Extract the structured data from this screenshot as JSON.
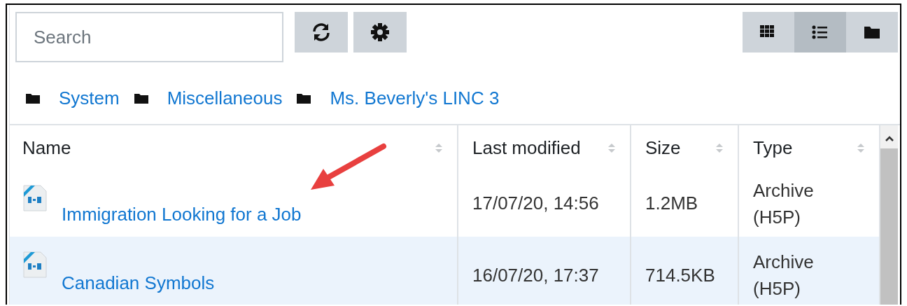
{
  "search": {
    "placeholder": "Search"
  },
  "toolbar_buttons": [
    {
      "kind": "refresh"
    },
    {
      "kind": "settings"
    }
  ],
  "view_modes": [
    {
      "kind": "icons",
      "selected": false
    },
    {
      "kind": "list",
      "selected": true
    },
    {
      "kind": "tree",
      "selected": false
    }
  ],
  "breadcrumb": [
    "System",
    "Miscellaneous",
    "Ms. Beverly's LINC 3"
  ],
  "table": {
    "columns": [
      "Name",
      "Last modified",
      "Size",
      "Type"
    ],
    "rows": [
      {
        "name": "Immigration Looking for a Job",
        "modified": "17/07/20, 14:56",
        "size": "1.2MB",
        "type": "Archive (H5P)",
        "selected": false
      },
      {
        "name": "Canadian Symbols",
        "modified": "16/07/20, 17:37",
        "size": "714.5KB",
        "type": "Archive (H5P)",
        "selected": true
      }
    ]
  }
}
